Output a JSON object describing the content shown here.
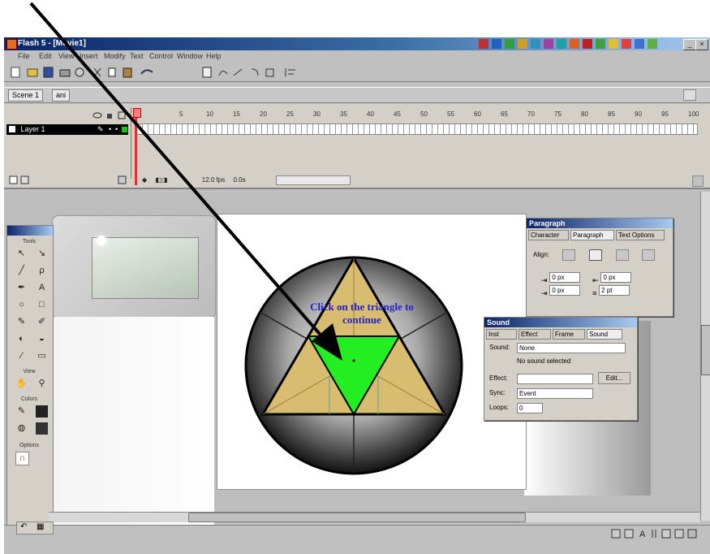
{
  "window": {
    "title": "Flash 5 - [Movie1]",
    "controls": [
      "_",
      "□",
      "×"
    ]
  },
  "menu": {
    "items": [
      "File",
      "Edit",
      "View",
      "Insert",
      "Modify",
      "Text",
      "Control",
      "Window",
      "Help"
    ]
  },
  "scene": {
    "scene_tab": "Scene 1",
    "symbol_tab": "ani"
  },
  "timeline": {
    "layer_name": "Layer 1",
    "frame_numbers": [
      "1",
      "5",
      "10",
      "15",
      "20",
      "25",
      "30",
      "35",
      "40",
      "45",
      "50",
      "55",
      "60",
      "65",
      "70",
      "75",
      "80",
      "85",
      "90",
      "95",
      "100"
    ],
    "fps": "12.0 fps",
    "time": "0.0s"
  },
  "stage": {
    "instruction_text": "Click on the triangle to continue"
  },
  "toolbox": {
    "sections": [
      "Tools",
      "View",
      "Colors",
      "Options"
    ]
  },
  "paragraph_panel": {
    "title": "Paragraph",
    "tabs": [
      "Character",
      "Paragraph",
      "Text Options"
    ],
    "align_label": "Align:",
    "indent_value": "0 px",
    "line_spacing_value": "2 pt"
  },
  "sound_panel": {
    "title": "Sound",
    "tabs": [
      "Inst",
      "Effect",
      "Frame",
      "Sound"
    ],
    "sound_label": "Sound:",
    "sound_value": "None",
    "status_text": "No sound selected",
    "effect_label": "Effect:",
    "edit_button": "Edit...",
    "sync_label": "Sync:",
    "sync_value": "Event",
    "loops_label": "Loops:",
    "loops_value": "0"
  },
  "colors": {
    "green_triangle": "#22ee22",
    "gold_triangle": "#d8bc70",
    "title_bar": "#0a246a",
    "instruction_text": "#2020cc"
  }
}
